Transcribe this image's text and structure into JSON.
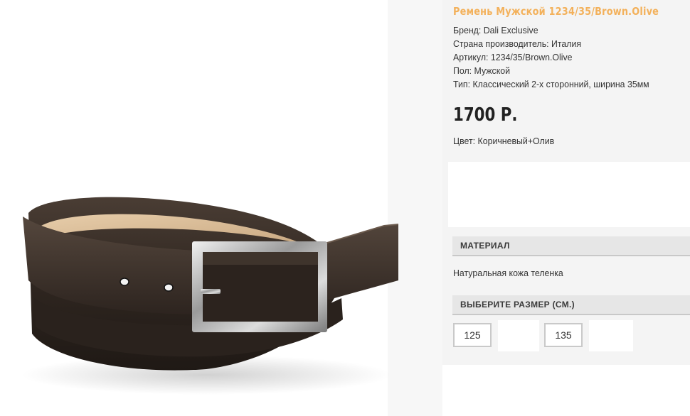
{
  "product": {
    "title": "Ремень Мужской 1234/35/Brown.Olive",
    "specs": [
      "Бренд: Dali Exclusive",
      "Страна производитель: Италия",
      "Артикул: 1234/35/Brown.Olive",
      "Пол: Мужской",
      "Тип: Классический 2-х сторонний, ширина 35мм"
    ],
    "price": "1700 Р.",
    "color": "Цвет: Коричневый+Олив",
    "image_alt": "belt-photo"
  },
  "material": {
    "header": "МАТЕРИАЛ",
    "text": "Натуральная кожа теленка"
  },
  "size": {
    "header": "ВЫБЕРИТЕ РАЗМЕР (СМ.)",
    "options": [
      "125",
      "135"
    ]
  },
  "colors": {
    "title": "#f3b15b",
    "panel_bg": "#f4f4f4",
    "header_bg": "#e6e6e6",
    "belt_leather": "#3a2f28",
    "belt_lining": "#d9b994",
    "buckle": "#b9b9b9"
  }
}
